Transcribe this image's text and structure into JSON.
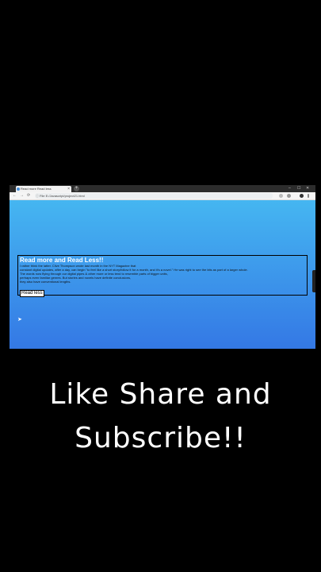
{
  "browser": {
    "tab_title": "Read more Read less",
    "tab_close_glyph": "×",
    "new_tab_glyph": "+",
    "window_controls": [
      "–",
      "☐",
      "✕"
    ],
    "nav": {
      "back": "←",
      "forward": "→",
      "reload": "⟳"
    },
    "url_prefix": "File",
    "url": "E:/Javascript/project21.html",
    "toolbar_icons": [
      "star-icon",
      "extension-icon",
      "profile-icon",
      "menu-icon"
    ]
  },
  "page": {
    "heading": "Read more and Read Less!!",
    "paragraph_lines": [
      "I rather think the latter. Clive Thompson wrote last month in the NYT Magazine that",
      "constant digital updates, after a day, can begin \"to feel like a short story/follow it for a month, and it's a novel.\" He was right to see the bits as part of a larger whole.",
      "The words now flying through our digital pipes & other more or less tend to resemble parts of bigger units,",
      "perhaps even familiar genres. But stories and novels have definite conclusions,",
      "they also have conventional lengths."
    ],
    "button_label": "Read less"
  },
  "cta": {
    "line1": "Like Share and",
    "line2": "Subscribe!!"
  },
  "colors": {
    "gradient_top": "#45b6f1",
    "gradient_bottom": "#3478e5",
    "background": "#000000"
  }
}
